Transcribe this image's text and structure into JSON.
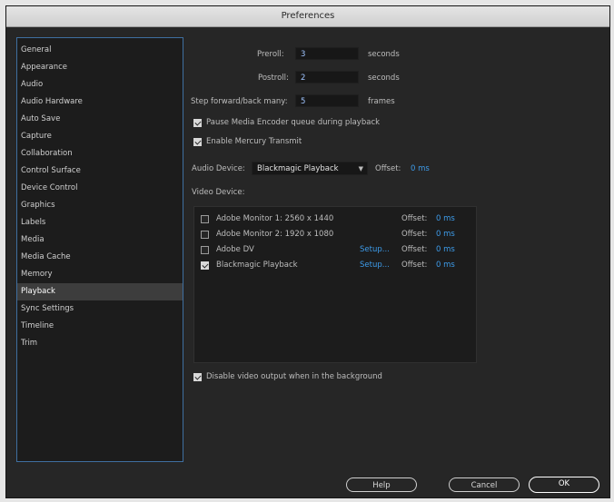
{
  "window": {
    "title": "Preferences"
  },
  "sidebar": {
    "items": [
      {
        "label": "General"
      },
      {
        "label": "Appearance"
      },
      {
        "label": "Audio"
      },
      {
        "label": "Audio Hardware"
      },
      {
        "label": "Auto Save"
      },
      {
        "label": "Capture"
      },
      {
        "label": "Collaboration"
      },
      {
        "label": "Control Surface"
      },
      {
        "label": "Device Control"
      },
      {
        "label": "Graphics"
      },
      {
        "label": "Labels"
      },
      {
        "label": "Media"
      },
      {
        "label": "Media Cache"
      },
      {
        "label": "Memory"
      },
      {
        "label": "Playback"
      },
      {
        "label": "Sync Settings"
      },
      {
        "label": "Timeline"
      },
      {
        "label": "Trim"
      }
    ],
    "selected": "Playback"
  },
  "playback": {
    "preroll": {
      "label": "Preroll:",
      "value": "3",
      "unit": "seconds"
    },
    "postroll": {
      "label": "Postroll:",
      "value": "2",
      "unit": "seconds"
    },
    "step": {
      "label": "Step forward/back many:",
      "value": "5",
      "unit": "frames"
    },
    "pause_media_encoder": {
      "label": "Pause Media Encoder queue during playback",
      "checked": true
    },
    "enable_mercury": {
      "label": "Enable Mercury Transmit",
      "checked": true
    },
    "audio_device": {
      "label": "Audio Device:",
      "value": "Blackmagic Playback",
      "offset_label": "Offset:",
      "offset_value": "0 ms"
    },
    "video_device_label": "Video Device:",
    "video_devices": [
      {
        "name": "Adobe Monitor 1: 2560 x 1440",
        "checked": false,
        "setup": "",
        "offset_label": "Offset:",
        "offset_value": "0 ms"
      },
      {
        "name": "Adobe Monitor 2: 1920 x 1080",
        "checked": false,
        "setup": "",
        "offset_label": "Offset:",
        "offset_value": "0 ms"
      },
      {
        "name": "Adobe DV",
        "checked": false,
        "setup": "Setup...",
        "offset_label": "Offset:",
        "offset_value": "0 ms"
      },
      {
        "name": "Blackmagic Playback",
        "checked": true,
        "setup": "Setup...",
        "offset_label": "Offset:",
        "offset_value": "0 ms"
      }
    ],
    "disable_video_output": {
      "label": "Disable video output when in the background",
      "checked": true
    }
  },
  "buttons": {
    "help": "Help",
    "cancel": "Cancel",
    "ok": "OK"
  },
  "colors": {
    "accent_blue": "#3d9be9",
    "selection": "#3d3d3d",
    "sidebar_border": "#3f6fa0"
  }
}
